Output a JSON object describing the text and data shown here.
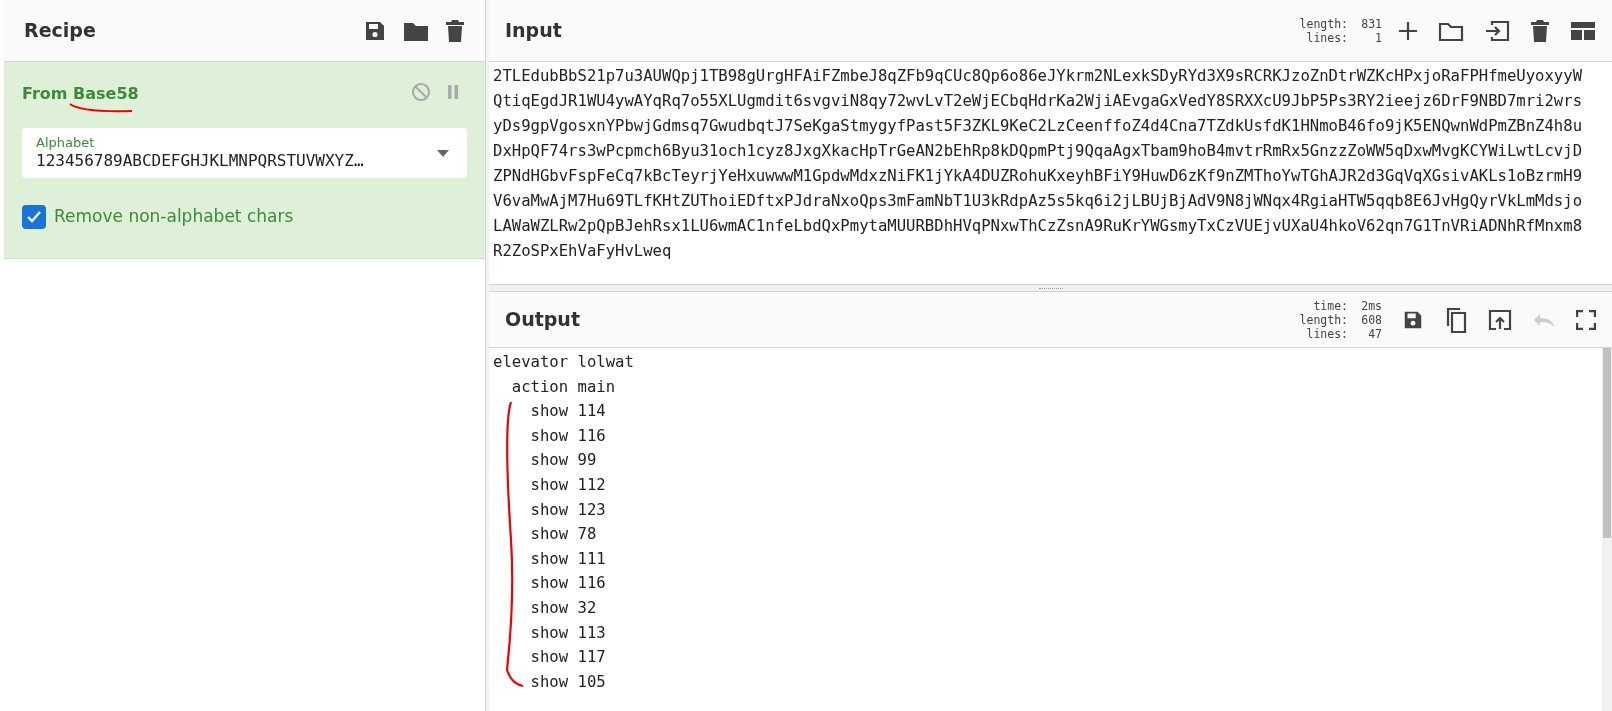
{
  "recipe": {
    "title": "Recipe",
    "operation": {
      "name": "From Base58",
      "disabled": false,
      "paused": false,
      "alphabet": {
        "label": "Alphabet",
        "value": "123456789ABCDEFGHJKLMNPQRSTUVWXYZ…"
      },
      "remove_non_alphabet": {
        "label": "Remove non-alphabet chars",
        "checked": true
      }
    }
  },
  "input": {
    "title": "Input",
    "stats": [
      {
        "label": "length:",
        "value": "831"
      },
      {
        "label": "lines:",
        "value": "1"
      }
    ],
    "lines": [
      "2TLEdubBbS21p7u3AUWQpj1TB98gUrgHFAiFZmbeJ8qZFb9qCUc8Qp6o86eJYkrm2NLexkSDyRYd3X9sRCRKJzoZnDtrWZKcHPxjoRaFPHfmeUyoxyyW",
      "QtiqEgdJR1WU4ywAYqRq7o55XLUgmdit6svgviN8qy72wvLvT2eWjECbqHdrKa2WjiAEvgaGxVedY8SRXXcU9JbP5Ps3RY2ieejz6DrF9NBD7mri2wrs",
      "yDs9gpVgosxnYPbwjGdmsq7GwudbqtJ7SeKgaStmygyfPast5F3ZKL9KeC2LzCeenffoZ4d4Cna7TZdkUsfdK1HNmoB46fo9jK5ENQwnWdPmZBnZ4h8u",
      "DxHpQF74rs3wPcpmch6Byu31och1cyz8JxgXkacHpTrGeAN2bEhRp8kDQpmPtj9QqaAgxTbam9hoB4mvtrRmRx5GnzzZoWW5qDxwMvgKCYWiLwtLcvjD",
      "ZPNdHGbvFspFeCq7kBcTeyrjYeHxuwwwM1GpdwMdxzNiFK1jYkA4DUZRohuKxeyhBFiY9HuwD6zKf9nZMThoYwTGhAJR2d3GqVqXGsivAKLs1oBzrmH9",
      "V6vaMwAjM7Hu69TLfKHtZUThoiEDftxPJdraNxoQps3mFamNbT1U3kRdpAz5s5kq6i2jLBUjBjAdV9N8jWNqx4RgiaHTW5qqb8E6JvHgQyrVkLmMdsjo",
      "LAWaWZLRw2pQpBJehRsx1LU6wmAC1nfeLbdQxPmytaMUURBDhHVqPNxwThCzZsnA9RuKrYWGsmyTxCzVUEjvUXaU4hkoV62qn7G1TnVRiADNhRfMnxm8",
      "R2ZoSPxEhVaFyHvLweq"
    ]
  },
  "output": {
    "title": "Output",
    "stats": [
      {
        "label": "time:",
        "value": "2ms"
      },
      {
        "label": "length:",
        "value": "608"
      },
      {
        "label": "lines:",
        "value": "47"
      }
    ],
    "undo_disabled": true,
    "lines": [
      "elevator lolwat",
      "  action main",
      "    show 114",
      "    show 116",
      "    show 99",
      "    show 112",
      "    show 123",
      "    show 78",
      "    show 111",
      "    show 116",
      "    show 32",
      "    show 113",
      "    show 117",
      "    show 105"
    ]
  }
}
